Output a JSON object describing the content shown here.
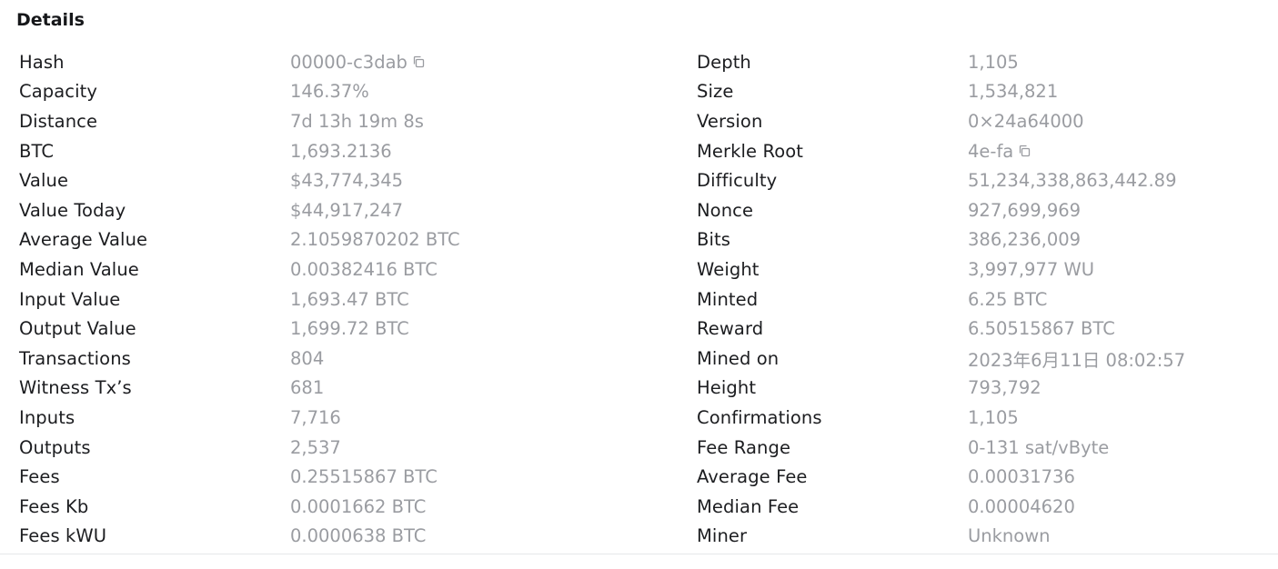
{
  "section_title": "Details",
  "left": [
    {
      "label": "Hash",
      "value": "00000-c3dab",
      "copy": true
    },
    {
      "label": "Capacity",
      "value": "146.37%"
    },
    {
      "label": "Distance",
      "value": "7d 13h 19m 8s"
    },
    {
      "label": "BTC",
      "value": "1,693.2136"
    },
    {
      "label": "Value",
      "value": "$43,774,345"
    },
    {
      "label": "Value Today",
      "value": "$44,917,247"
    },
    {
      "label": "Average Value",
      "value": "2.1059870202 BTC"
    },
    {
      "label": "Median Value",
      "value": "0.00382416 BTC"
    },
    {
      "label": "Input Value",
      "value": "1,693.47 BTC"
    },
    {
      "label": "Output Value",
      "value": "1,699.72 BTC"
    },
    {
      "label": "Transactions",
      "value": "804"
    },
    {
      "label": "Witness Tx’s",
      "value": "681"
    },
    {
      "label": "Inputs",
      "value": "7,716"
    },
    {
      "label": "Outputs",
      "value": "2,537"
    },
    {
      "label": "Fees",
      "value": "0.25515867 BTC"
    },
    {
      "label": "Fees Kb",
      "value": "0.0001662 BTC"
    },
    {
      "label": "Fees kWU",
      "value": "0.0000638 BTC"
    }
  ],
  "right": [
    {
      "label": "Depth",
      "value": "1,105"
    },
    {
      "label": "Size",
      "value": "1,534,821"
    },
    {
      "label": "Version",
      "value": "0×24a64000"
    },
    {
      "label": "Merkle Root",
      "value": "4e-fa",
      "copy": true
    },
    {
      "label": "Difficulty",
      "value": "51,234,338,863,442.89"
    },
    {
      "label": "Nonce",
      "value": "927,699,969"
    },
    {
      "label": "Bits",
      "value": "386,236,009"
    },
    {
      "label": "Weight",
      "value": "3,997,977 WU"
    },
    {
      "label": "Minted",
      "value": "6.25 BTC"
    },
    {
      "label": "Reward",
      "value": "6.50515867 BTC"
    },
    {
      "label": "Mined on",
      "value": "2023年6月11日 08:02:57"
    },
    {
      "label": "Height",
      "value": "793,792"
    },
    {
      "label": "Confirmations",
      "value": "1,105"
    },
    {
      "label": "Fee Range",
      "value": "0-131 sat/vByte"
    },
    {
      "label": "Average Fee",
      "value": "0.00031736"
    },
    {
      "label": "Median Fee",
      "value": "0.00004620"
    },
    {
      "label": "Miner",
      "value": "Unknown"
    }
  ],
  "icons": {
    "copy": "copy-icon"
  },
  "colors": {
    "label": "#1c1d20",
    "value": "#9a9ca1",
    "divider": "#e6e7ea"
  }
}
